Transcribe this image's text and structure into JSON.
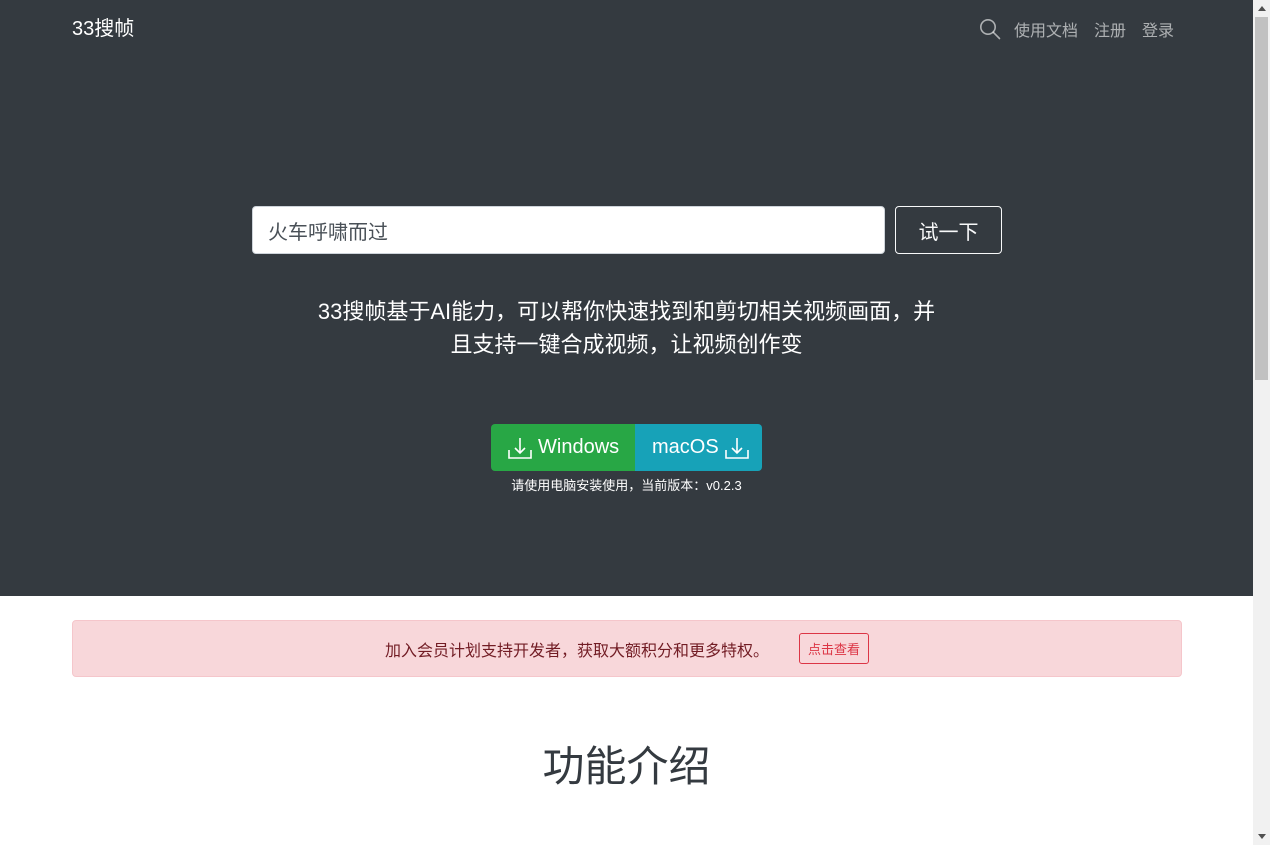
{
  "nav": {
    "brand": "33搜帧",
    "links": [
      "使用文档",
      "注册",
      "登录"
    ],
    "search_icon": "search-icon"
  },
  "hero": {
    "search_value": "火车呼啸而过",
    "try_button": "试一下",
    "lead_line1": "33搜帧基于AI能力，可以帮你快速找到和剪切相关视频画面，并",
    "lead_line2": "且支持一键合成视频，让视频创作变",
    "download_windows": "Windows",
    "download_macos": "macOS",
    "download_icon": "download-icon",
    "version_note": "请使用电脑安装使用，当前版本：v0.2.3"
  },
  "alert": {
    "text": "加入会员计划支持开发者，获取大额积分和更多特权。",
    "button": "点击查看"
  },
  "section": {
    "title": "功能介绍"
  },
  "colors": {
    "hero_bg": "#343a40",
    "windows_btn": "#28a745",
    "macos_btn": "#17a2b8",
    "alert_bg": "#f8d7da",
    "alert_text": "#721c24",
    "alert_btn": "#dc3545"
  }
}
